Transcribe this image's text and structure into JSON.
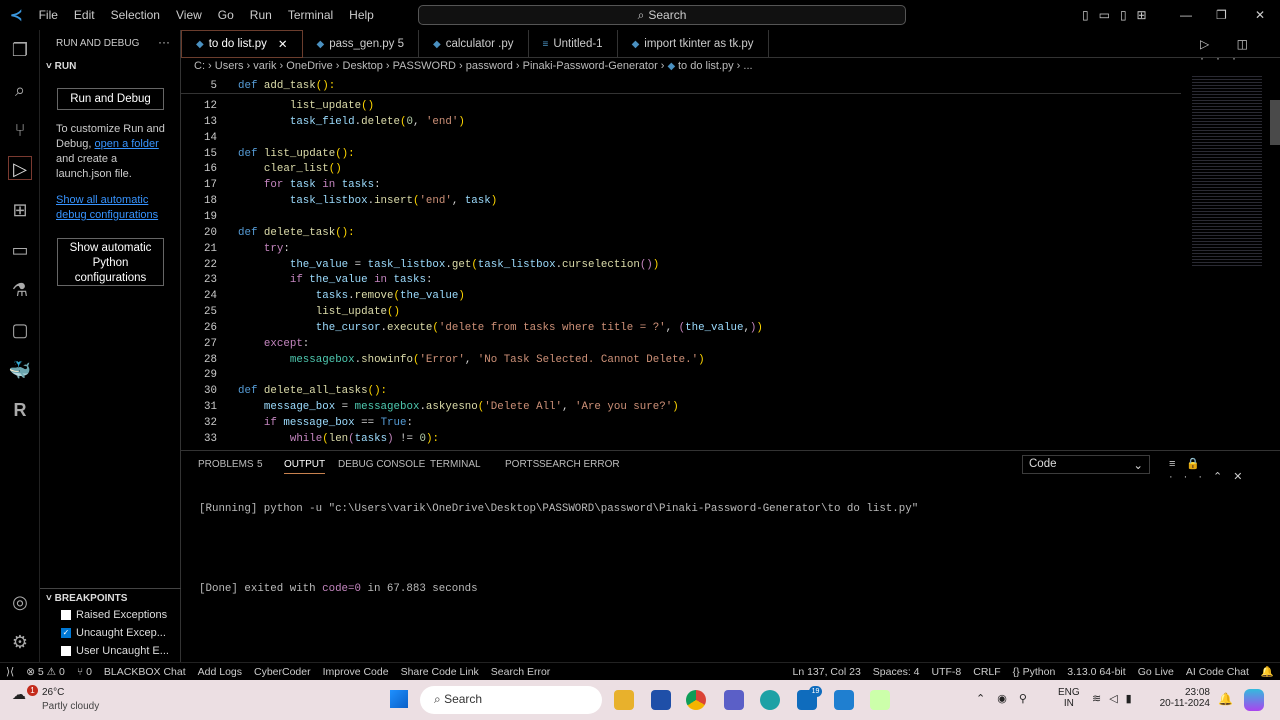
{
  "menu": [
    "File",
    "Edit",
    "Selection",
    "View",
    "Go",
    "Run",
    "Terminal",
    "Help"
  ],
  "search_label": "Search",
  "sidebar": {
    "title": "RUN AND DEBUG",
    "section": "RUN",
    "run_button": "Run and Debug",
    "text1": "To customize Run and Debug,",
    "link1": "open a folder",
    "text2": "and create a launch.json file.",
    "link2": "Show all automatic debug configurations",
    "python_button": "Show automatic Python configurations",
    "breakpoints_title": "BREAKPOINTS",
    "breakpoints": [
      {
        "label": "Raised Exceptions",
        "checked": false
      },
      {
        "label": "Uncaught Excep...",
        "checked": true
      },
      {
        "label": "User Uncaught E...",
        "checked": false
      }
    ]
  },
  "tabs": [
    {
      "label": "to do list.py",
      "icon": "python"
    },
    {
      "label": "pass_gen.py 5",
      "icon": "python"
    },
    {
      "label": "calculator .py",
      "icon": "python"
    },
    {
      "label": "Untitled-1",
      "icon": "text"
    },
    {
      "label": "import tkinter as tk.py",
      "icon": "python"
    }
  ],
  "breadcrumb": "C: › Users › varik › OneDrive › Desktop › PASSWORD › password › Pinaki-Password-Generator › ",
  "breadcrumb_file": "to do list.py › ...",
  "code": [
    {
      "n": "5",
      "t": [
        [
          "def ",
          "k"
        ],
        [
          "add_task",
          "f"
        ],
        [
          "():",
          "y"
        ]
      ]
    },
    {
      "n": "12",
      "t": [
        [
          "        list_update",
          "f"
        ],
        [
          "()",
          "y"
        ]
      ]
    },
    {
      "n": "13",
      "t": [
        [
          "        task_field",
          "v"
        ],
        [
          ".",
          "p"
        ],
        [
          "delete",
          "f"
        ],
        [
          "(",
          "y"
        ],
        [
          "0",
          "n"
        ],
        [
          ", ",
          "p"
        ],
        [
          "'end'",
          "s"
        ],
        [
          ")",
          "y"
        ]
      ]
    },
    {
      "n": "14",
      "t": []
    },
    {
      "n": "15",
      "t": [
        [
          "def ",
          "k"
        ],
        [
          "list_update",
          "f"
        ],
        [
          "():",
          "y"
        ]
      ]
    },
    {
      "n": "16",
      "t": [
        [
          "    clear_list",
          "f"
        ],
        [
          "()",
          "y"
        ]
      ]
    },
    {
      "n": "17",
      "t": [
        [
          "    for ",
          "c"
        ],
        [
          "task ",
          "v"
        ],
        [
          "in ",
          "c"
        ],
        [
          "tasks",
          "v"
        ],
        [
          ":",
          "p"
        ]
      ]
    },
    {
      "n": "18",
      "t": [
        [
          "        task_listbox",
          "v"
        ],
        [
          ".",
          "p"
        ],
        [
          "insert",
          "f"
        ],
        [
          "(",
          "y"
        ],
        [
          "'end'",
          "s"
        ],
        [
          ", ",
          "p"
        ],
        [
          "task",
          "v"
        ],
        [
          ")",
          "y"
        ]
      ]
    },
    {
      "n": "19",
      "t": []
    },
    {
      "n": "20",
      "t": [
        [
          "def ",
          "k"
        ],
        [
          "delete_task",
          "f"
        ],
        [
          "():",
          "y"
        ]
      ]
    },
    {
      "n": "21",
      "t": [
        [
          "    try",
          "c"
        ],
        [
          ":",
          "p"
        ]
      ]
    },
    {
      "n": "22",
      "t": [
        [
          "        the_value ",
          "v"
        ],
        [
          "= ",
          "p"
        ],
        [
          "task_listbox",
          "v"
        ],
        [
          ".",
          "p"
        ],
        [
          "get",
          "f"
        ],
        [
          "(",
          "y"
        ],
        [
          "task_listbox",
          "v"
        ],
        [
          ".",
          "p"
        ],
        [
          "curselection",
          "f"
        ],
        [
          "()",
          "c"
        ],
        [
          ")",
          "y"
        ]
      ]
    },
    {
      "n": "23",
      "t": [
        [
          "        if ",
          "c"
        ],
        [
          "the_value ",
          "v"
        ],
        [
          "in ",
          "c"
        ],
        [
          "tasks",
          "v"
        ],
        [
          ":",
          "p"
        ]
      ]
    },
    {
      "n": "24",
      "t": [
        [
          "            tasks",
          "v"
        ],
        [
          ".",
          "p"
        ],
        [
          "remove",
          "f"
        ],
        [
          "(",
          "y"
        ],
        [
          "the_value",
          "v"
        ],
        [
          ")",
          "y"
        ]
      ]
    },
    {
      "n": "25",
      "t": [
        [
          "            list_update",
          "f"
        ],
        [
          "()",
          "y"
        ]
      ]
    },
    {
      "n": "26",
      "t": [
        [
          "            the_cursor",
          "v"
        ],
        [
          ".",
          "p"
        ],
        [
          "execute",
          "f"
        ],
        [
          "(",
          "y"
        ],
        [
          "'delete from tasks where title = ?'",
          "s"
        ],
        [
          ", ",
          "p"
        ],
        [
          "(",
          "c"
        ],
        [
          "the_value",
          "v"
        ],
        [
          ",",
          "p"
        ],
        [
          ")",
          "c"
        ],
        [
          ")",
          "y"
        ]
      ]
    },
    {
      "n": "27",
      "t": [
        [
          "    except",
          "c"
        ],
        [
          ":",
          "p"
        ]
      ]
    },
    {
      "n": "28",
      "t": [
        [
          "        messagebox",
          "t"
        ],
        [
          ".",
          "p"
        ],
        [
          "showinfo",
          "f"
        ],
        [
          "(",
          "y"
        ],
        [
          "'Error'",
          "s"
        ],
        [
          ", ",
          "p"
        ],
        [
          "'No Task Selected. Cannot Delete.'",
          "s"
        ],
        [
          ")",
          "y"
        ]
      ]
    },
    {
      "n": "29",
      "t": []
    },
    {
      "n": "30",
      "t": [
        [
          "def ",
          "k"
        ],
        [
          "delete_all_tasks",
          "f"
        ],
        [
          "():",
          "y"
        ]
      ]
    },
    {
      "n": "31",
      "t": [
        [
          "    message_box ",
          "v"
        ],
        [
          "= ",
          "p"
        ],
        [
          "messagebox",
          "t"
        ],
        [
          ".",
          "p"
        ],
        [
          "askyesno",
          "f"
        ],
        [
          "(",
          "y"
        ],
        [
          "'Delete All'",
          "s"
        ],
        [
          ", ",
          "p"
        ],
        [
          "'Are you sure?'",
          "s"
        ],
        [
          ")",
          "y"
        ]
      ]
    },
    {
      "n": "32",
      "t": [
        [
          "    if ",
          "c"
        ],
        [
          "message_box ",
          "v"
        ],
        [
          "== ",
          "p"
        ],
        [
          "True",
          "k"
        ],
        [
          ":",
          "p"
        ]
      ]
    },
    {
      "n": "33",
      "t": [
        [
          "        while",
          "c"
        ],
        [
          "(",
          "y"
        ],
        [
          "len",
          "f"
        ],
        [
          "(",
          "c"
        ],
        [
          "tasks",
          "v"
        ],
        [
          ") ",
          "c"
        ],
        [
          "!= ",
          "p"
        ],
        [
          "0",
          "n"
        ],
        [
          "):",
          "y"
        ]
      ]
    }
  ],
  "panel": {
    "tabs": [
      "PROBLEMS",
      "OUTPUT",
      "DEBUG CONSOLE",
      "TERMINAL",
      "PORTS",
      "SEARCH ERROR"
    ],
    "problems_count": "5",
    "active_tab": "OUTPUT",
    "channel": "Code",
    "running": "[Running] python -u \"c:\\Users\\varik\\OneDrive\\Desktop\\PASSWORD\\password\\Pinaki-Password-Generator\\to do list.py\"",
    "done_prefix": "[Done] exited with ",
    "done_code": "code=0",
    "done_suffix": " in 67.883 seconds"
  },
  "status": {
    "left": [
      "⊗ 5 ⚠ 0",
      "⑂ 0",
      "BLACKBOX Chat",
      "Add Logs",
      "CyberCoder",
      "Improve Code",
      "Share Code Link",
      "Search Error"
    ],
    "right": [
      "Ln 137, Col 23",
      "Spaces: 4",
      "UTF-8",
      "CRLF",
      "{} Python",
      "3.13.0 64-bit",
      "Go Live",
      "AI Code Chat"
    ]
  },
  "taskbar": {
    "temp": "26°C",
    "weather": "Partly cloudy",
    "search": "Search",
    "lang1": "ENG",
    "lang2": "IN",
    "time": "23:08",
    "date": "20-11-2024",
    "weather_badge": "1",
    "mail_badge": "19"
  },
  "colors": {
    "accent": "#0078d4",
    "link": "#3794ff"
  }
}
